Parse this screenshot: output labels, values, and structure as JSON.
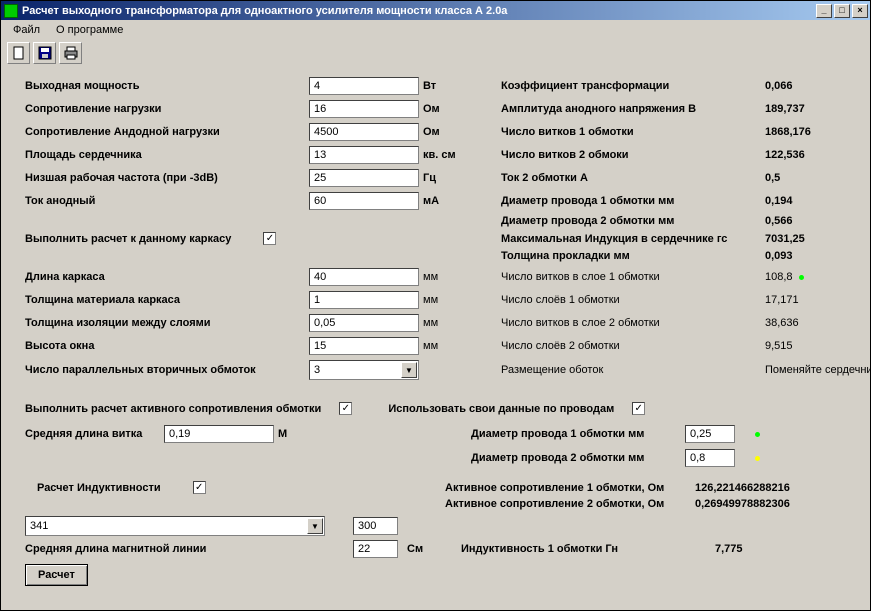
{
  "window": {
    "title": "Расчет выходного трансформатора для одноактного  усилителя мощности класса А  2.0а"
  },
  "menu": {
    "file": "Файл",
    "about": "О программе"
  },
  "toolbar": {
    "new": "new-icon",
    "save": "save-icon",
    "print": "print-icon"
  },
  "inputsBlock1": {
    "outputPower": {
      "label": "Выходная мощность",
      "value": "4",
      "unit": "Вт"
    },
    "loadResistance": {
      "label": "Сопротивление нагрузки",
      "value": "16",
      "unit": "Ом"
    },
    "anodeLoadResistance": {
      "label": "Сопротивление Андодной нагрузки",
      "value": "4500",
      "unit": "Ом"
    },
    "coreArea": {
      "label": "Площадь сердечника",
      "value": "13",
      "unit": "кв. см"
    },
    "lowFreq": {
      "label": "Низшая рабочая частота (при -3dB)",
      "value": "25",
      "unit": "Гц"
    },
    "anodeCurrent": {
      "label": "Ток анодный",
      "value": "60",
      "unit": "мА"
    }
  },
  "outputs1": {
    "transRatio": {
      "label": "Коэффициент трансформации",
      "value": "0,066"
    },
    "anodeVoltAmp": {
      "label": "Амплитуда анодного напряжения В",
      "value": "189,737"
    },
    "turns1": {
      "label": "Число витков 1 обмотки",
      "value": "1868,176"
    },
    "turns2": {
      "label": "Число витков 2 обмоки",
      "value": "122,536"
    },
    "current2": {
      "label": "Ток 2 обмотки А",
      "value": "0,5"
    },
    "wireDia1": {
      "label": "Диаметр провода 1 обмотки мм",
      "value": "0,194"
    },
    "wireDia2": {
      "label": "Диаметр провода 2 обмотки мм",
      "value": "0,566"
    },
    "maxInduction": {
      "label": "Максимальная Индукция в сердечнике гс",
      "value": "7031,25"
    },
    "gasketThickness": {
      "label": "Толщина прокладки мм",
      "value": "0,093"
    }
  },
  "frameCalc": {
    "toThisFrame": {
      "label": "Выполнить расчет к данному каркасу",
      "checked": true
    },
    "frameLength": {
      "label": "Длина каркаса",
      "value": "40",
      "unit": "мм"
    },
    "frameMatThickness": {
      "label": "Толщина материала каркаса",
      "value": "1",
      "unit": "мм"
    },
    "layerInsulation": {
      "label": "Толщина изоляции между слоями",
      "value": "0,05",
      "unit": "мм"
    },
    "windowHeight": {
      "label": "Высота окна",
      "value": "15",
      "unit": "мм"
    },
    "parallelSecondaries": {
      "label": "Число параллельных вторичных обмоток",
      "value": "3"
    }
  },
  "outputs2": {
    "turnsPerLayer1": {
      "label": "Число витков в слое 1 обмотки",
      "value": "108,8"
    },
    "layers1": {
      "label": "Число слоёв 1 обмотки",
      "value": "17,171"
    },
    "turnsPerLayer2": {
      "label": "Число витков в слое 2 обмотки",
      "value": "38,636"
    },
    "layers2": {
      "label": "Число слоёв 2 обмотки",
      "value": "9,515"
    },
    "placement": {
      "label": "Размещение оботок",
      "value": "Поменяйте сердечник"
    }
  },
  "resistanceCalc": {
    "doCalc": {
      "label": "Выполнить расчет активного сопротивления обмотки",
      "checked": true
    },
    "useOwnWire": {
      "label": "Использовать свои данные по проводам",
      "checked": true
    },
    "avgTurnLength": {
      "label": "Средняя длина витка",
      "value": "0,19",
      "unit": "М"
    },
    "wireDia1In": {
      "label": "Диаметр провода 1 обмотки мм",
      "value": "0,25"
    },
    "wireDia2In": {
      "label": "Диаметр провода 2 обмотки мм",
      "value": "0,8"
    },
    "activeR1": {
      "label": "Активное сопротивление 1 обмотки, Ом",
      "value": "126,221466288216"
    },
    "activeR2": {
      "label": "Активное сопротивление 2 обмотки, Ом",
      "value": "0,26949978882306"
    }
  },
  "inductance": {
    "doCalc": {
      "label": "Расчет Индуктивности",
      "checked": true
    },
    "selectValue": "341",
    "value1": "300",
    "value2": "22",
    "unit2": "См",
    "avgMagLine": {
      "label": "Средняя длина магнитной линии"
    },
    "result": {
      "label": "Индуктивность 1 обмотки Гн",
      "value": "7,775"
    }
  },
  "buttons": {
    "calculate": "Расчет"
  }
}
